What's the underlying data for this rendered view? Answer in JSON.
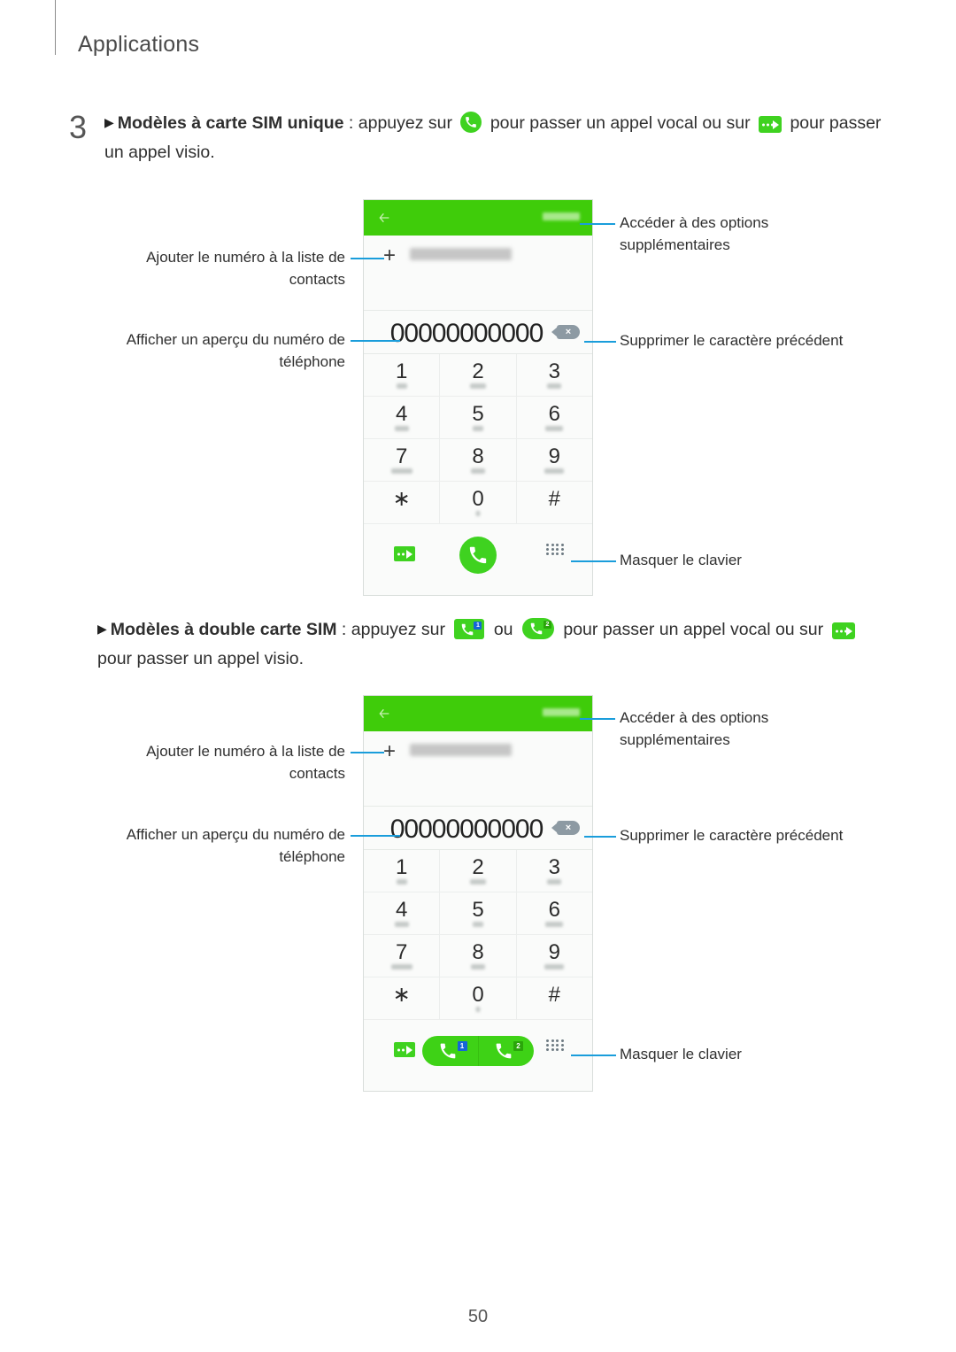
{
  "header": {
    "title": "Applications"
  },
  "step": {
    "number": "3",
    "arrow": "▶",
    "bold_lead": "Modèles à carte SIM unique",
    "text_a": " : appuyez sur ",
    "text_b": " pour passer un appel vocal ou sur ",
    "text_c": " pour passer un appel visio."
  },
  "para2": {
    "arrow": "▶",
    "bold_lead": "Modèles à double carte SIM",
    "text_a": " : appuyez sur ",
    "text_or": " ou ",
    "text_b": " pour passer un appel vocal ou sur ",
    "text_c": " pour passer un appel visio."
  },
  "callouts": {
    "add_contact": "Ajouter le numéro à la liste de contacts",
    "preview_number": "Afficher un aperçu du numéro de téléphone",
    "more_options": "Accéder à des options supplémentaires",
    "delete_char": "Supprimer le caractère précédent",
    "hide_keypad": "Masquer le clavier"
  },
  "phone": {
    "back_icon": "back-arrow-icon",
    "more_label": "MORE",
    "add_to_contacts_label": "Add to Contacts",
    "plus": "+",
    "number": "00000000000",
    "backspace_glyph": "×",
    "keys": [
      {
        "main": "1",
        "sub_w": 12
      },
      {
        "main": "2",
        "sub_w": 18
      },
      {
        "main": "3",
        "sub_w": 16
      },
      {
        "main": "4",
        "sub_w": 16
      },
      {
        "main": "5",
        "sub_w": 12
      },
      {
        "main": "6",
        "sub_w": 20
      },
      {
        "main": "7",
        "sub_w": 24
      },
      {
        "main": "8",
        "sub_w": 16
      },
      {
        "main": "9",
        "sub_w": 22
      },
      {
        "main": "∗",
        "sub_w": 0
      },
      {
        "main": "0",
        "sub_w": 5
      },
      {
        "main": "#",
        "sub_w": 0
      }
    ],
    "action_video": "video-call-icon",
    "action_call": "call-icon",
    "action_keypad": "hide-keypad-icon",
    "sim_badge_1": "1",
    "sim_badge_2": "2"
  },
  "colors": {
    "brand_green": "#3fcc0a",
    "icon_green": "#3fd220",
    "leader_blue": "#1a9ddb",
    "badge_blue": "#1565d8",
    "badge_green": "#2aa50a"
  },
  "footer": {
    "page_number": "50"
  }
}
